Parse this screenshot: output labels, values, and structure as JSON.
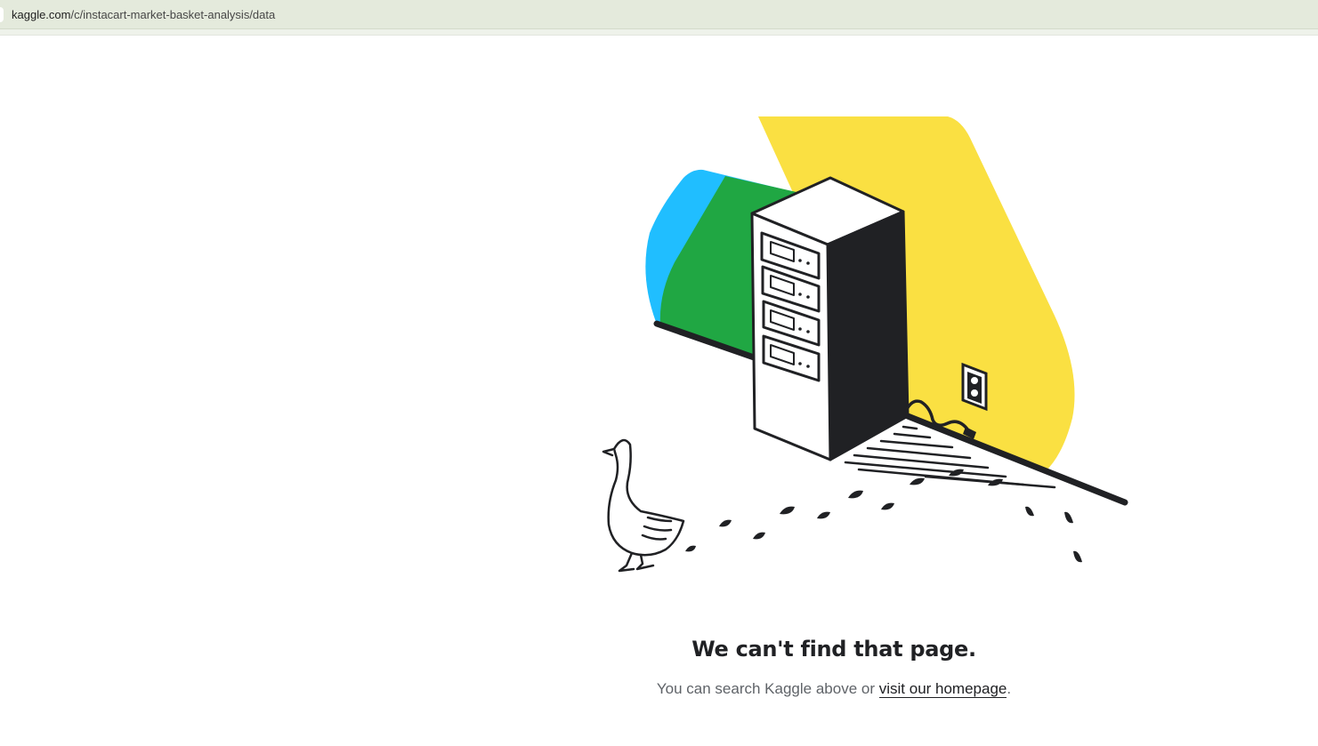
{
  "browser": {
    "url_host": "kaggle.com",
    "url_path": "/c/instacart-market-basket-analysis/data"
  },
  "error_page": {
    "heading": "We can't find that page.",
    "message_before": "You can search Kaggle above or ",
    "link_text": "visit our homepage",
    "message_after": "."
  },
  "illustration": {
    "subject": "goose following footprints near an unplugged server cabinet",
    "colors": {
      "yellow": "#fae042",
      "blue": "#20beff",
      "green": "#20a743",
      "ink": "#202124"
    }
  }
}
